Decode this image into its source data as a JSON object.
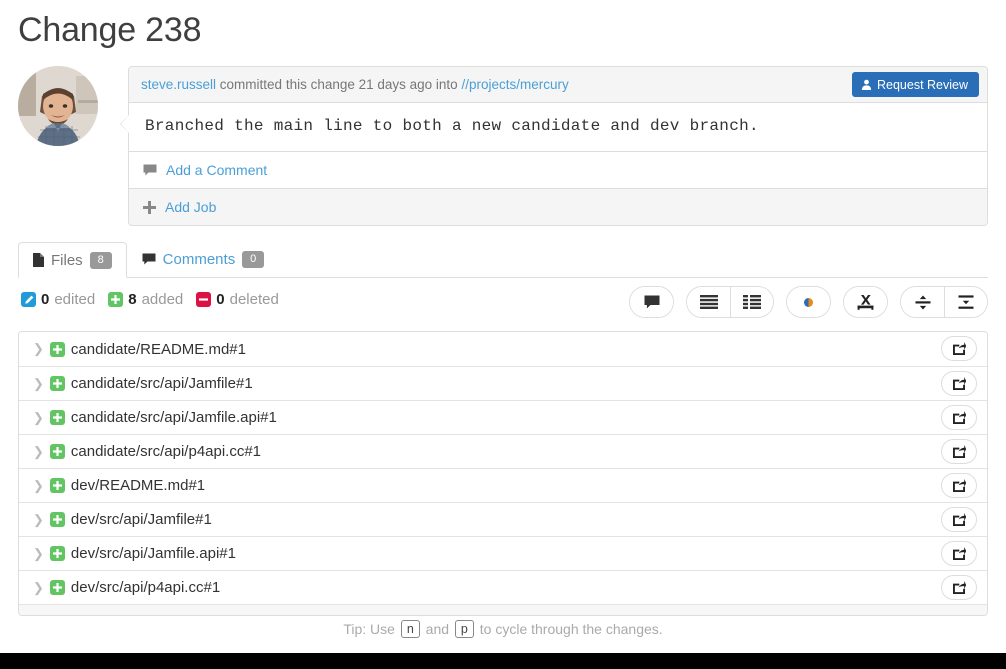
{
  "page": {
    "title": "Change 238"
  },
  "commit": {
    "author": "steve.russell",
    "action_text": "committed this change 21 days ago into",
    "branch_path": "//projects/mercury",
    "description": "Branched the main line to both a new candidate and dev branch.",
    "request_review_label": "Request Review",
    "request_review_icon": "user-icon",
    "avatar_icon": "user-avatar-photo",
    "actions": [
      {
        "label": "Add a Comment",
        "icon": "comment-icon"
      },
      {
        "label": "Add Job",
        "icon": "plus-icon"
      }
    ]
  },
  "tabs": [
    {
      "label": "Files",
      "count": "8",
      "icon": "file-icon",
      "active": true
    },
    {
      "label": "Comments",
      "count": "0",
      "icon": "comment-icon",
      "active": false
    }
  ],
  "stats": [
    {
      "count": "0",
      "label": "edited",
      "color": "#1f9bd8",
      "icon": "pencil-icon"
    },
    {
      "count": "8",
      "label": "added",
      "color": "#62c462",
      "icon": "plus-icon"
    },
    {
      "count": "0",
      "label": "deleted",
      "color": "#dd1144",
      "icon": "minus-icon"
    }
  ],
  "toolbar": [
    {
      "name": "toggle-comments-button",
      "icon": "comment-icon"
    },
    {
      "name": "view-unified-button",
      "icon": "list-lines-icon"
    },
    {
      "name": "view-side-by-side-button",
      "icon": "list-grid-icon"
    },
    {
      "name": "toggle-whitespace-button",
      "icon": "dot-icon"
    },
    {
      "name": "download-zip-button",
      "icon": "archive-download-icon"
    },
    {
      "name": "collapse-all-button",
      "icon": "collapse-icon"
    },
    {
      "name": "expand-all-button",
      "icon": "expand-icon"
    }
  ],
  "files": [
    {
      "path": "candidate/README.md#1",
      "status": "added"
    },
    {
      "path": "candidate/src/api/Jamfile#1",
      "status": "added"
    },
    {
      "path": "candidate/src/api/Jamfile.api#1",
      "status": "added"
    },
    {
      "path": "candidate/src/api/p4api.cc#1",
      "status": "added"
    },
    {
      "path": "dev/README.md#1",
      "status": "added"
    },
    {
      "path": "dev/src/api/Jamfile#1",
      "status": "added"
    },
    {
      "path": "dev/src/api/Jamfile.api#1",
      "status": "added"
    },
    {
      "path": "dev/src/api/p4api.cc#1",
      "status": "added"
    }
  ],
  "file_row": {
    "expand_icon": "chevron-right-icon",
    "open_icon": "open-external-icon",
    "added_icon": "plus-icon"
  },
  "tip": {
    "prefix": "Tip: Use",
    "key1": "n",
    "middle": "and",
    "key2": "p",
    "suffix": "to cycle through the changes."
  },
  "colors": {
    "link": "#4b9fd5",
    "primary_button": "#2a6eb7",
    "added": "#62c462",
    "deleted": "#dd1144",
    "edited": "#1f9bd8"
  }
}
